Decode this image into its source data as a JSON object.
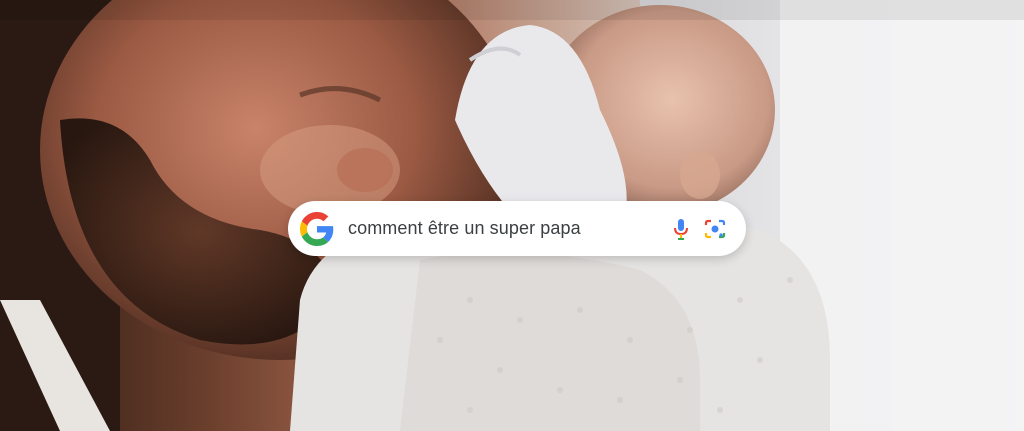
{
  "search": {
    "query": "comment être un super papa"
  },
  "icons": {
    "logo": "google-g-icon",
    "voice": "microphone-icon",
    "lens": "camera-lens-icon"
  },
  "colors": {
    "google_blue": "#4285F4",
    "google_red": "#EA4335",
    "google_yellow": "#FBBC05",
    "google_green": "#34A853",
    "pill_background": "#FFFFFF",
    "query_text": "#3C4043"
  }
}
